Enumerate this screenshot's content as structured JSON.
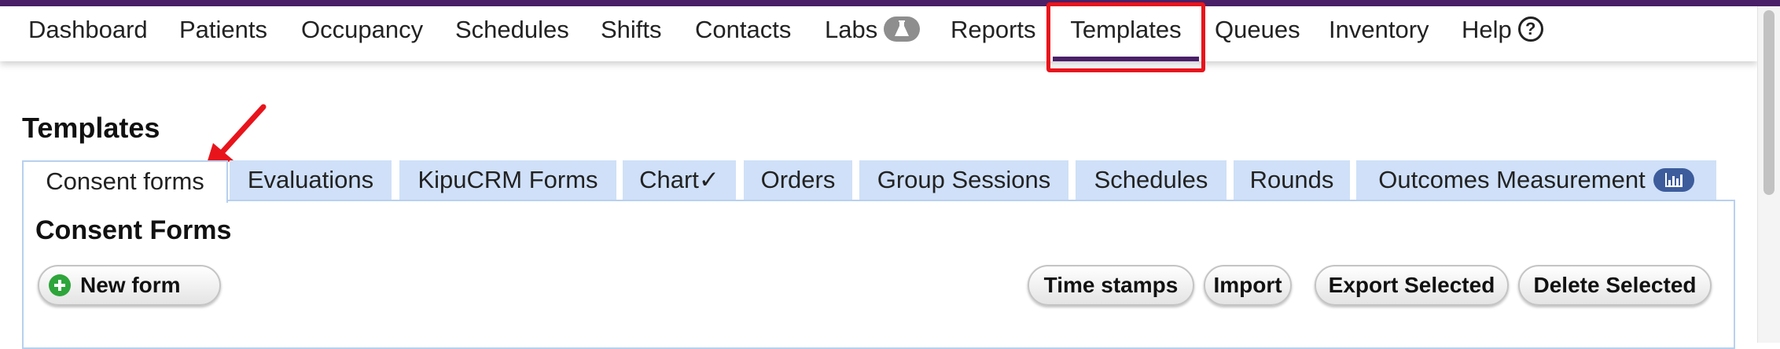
{
  "nav": {
    "items": [
      {
        "label": "Dashboard"
      },
      {
        "label": "Patients"
      },
      {
        "label": "Occupancy"
      },
      {
        "label": "Schedules"
      },
      {
        "label": "Shifts"
      },
      {
        "label": "Contacts"
      },
      {
        "label": "Labs",
        "icon": "flask-icon"
      },
      {
        "label": "Reports"
      },
      {
        "label": "Templates",
        "active": true
      },
      {
        "label": "Queues"
      },
      {
        "label": "Inventory"
      },
      {
        "label": "Help",
        "icon": "question-circle-icon",
        "icon_text": "?"
      }
    ]
  },
  "page": {
    "title": "Templates"
  },
  "tabs": [
    {
      "label": "Consent forms",
      "active": true
    },
    {
      "label": "Evaluations"
    },
    {
      "label": "KipuCRM Forms"
    },
    {
      "label": "Chart✓"
    },
    {
      "label": "Orders"
    },
    {
      "label": "Group Sessions"
    },
    {
      "label": "Schedules"
    },
    {
      "label": "Rounds"
    },
    {
      "label": "Outcomes Measurement",
      "icon": "bar-chart-icon"
    }
  ],
  "section": {
    "title": "Consent Forms"
  },
  "buttons": {
    "new_form": "New form",
    "time_stamps": "Time stamps",
    "import": "Import",
    "export_selected": "Export Selected",
    "delete_selected": "Delete Selected"
  },
  "colors": {
    "brand_purple": "#4a2068",
    "highlight_red": "#e8141c",
    "tab_blue": "#cfe0f8",
    "badge_navy": "#3d5c9c",
    "plus_green": "#2ea53b"
  }
}
